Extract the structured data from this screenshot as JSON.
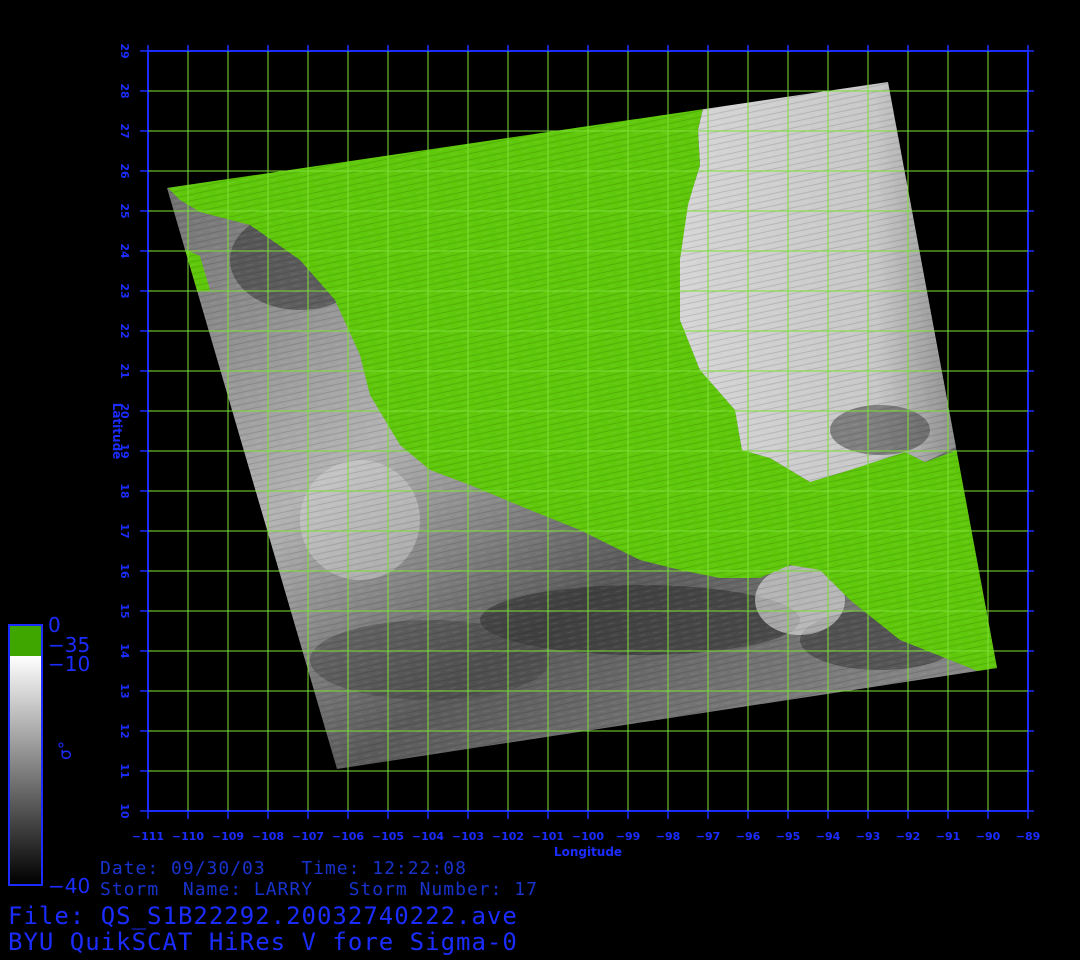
{
  "map": {
    "x_axis_label": "Longitude",
    "y_axis_label": "Latitude",
    "lon_ticks": [
      "−111",
      "−110",
      "−109",
      "−108",
      "−107",
      "−106",
      "−105",
      "−104",
      "−103",
      "−102",
      "−101",
      "−100",
      "−99",
      "−98",
      "−97",
      "−96",
      "−95",
      "−94",
      "−93",
      "−92",
      "−91",
      "−90",
      "−89"
    ],
    "lat_ticks": [
      "10",
      "11",
      "12",
      "13",
      "14",
      "15",
      "16",
      "17",
      "18",
      "19",
      "20",
      "21",
      "22",
      "23",
      "24",
      "25",
      "26",
      "27",
      "28",
      "29"
    ],
    "lon_range": [
      -111,
      -89
    ],
    "lat_range": [
      10,
      29
    ],
    "grid_color": "#7ee036",
    "axis_color": "#1b2cff",
    "land_color": "#5fc80a",
    "swath_corners_lonlat": [
      [
        -110.5,
        25.6
      ],
      [
        -92.5,
        28.2
      ],
      [
        -89.8,
        13.6
      ],
      [
        -105.8,
        11.1
      ]
    ]
  },
  "colorbar": {
    "land_top_label": "0",
    "land_bottom_label": "−35",
    "top_label": "−10",
    "bottom_label": "−40",
    "quantity_label": "σ°",
    "colors": {
      "land": "#3fa600",
      "high": "#ffffff",
      "low": "#000000",
      "frame": "#1b2cff"
    }
  },
  "info": {
    "date_line": "Date: 09/30/03   Time: 12:22:08",
    "storm_line": "Storm  Name: LARRY   Storm Number: 17",
    "file_line": "File: QS_S1B22292.20032740222.ave",
    "product_line": "BYU QuikSCAT HiRes V fore Sigma-0"
  }
}
